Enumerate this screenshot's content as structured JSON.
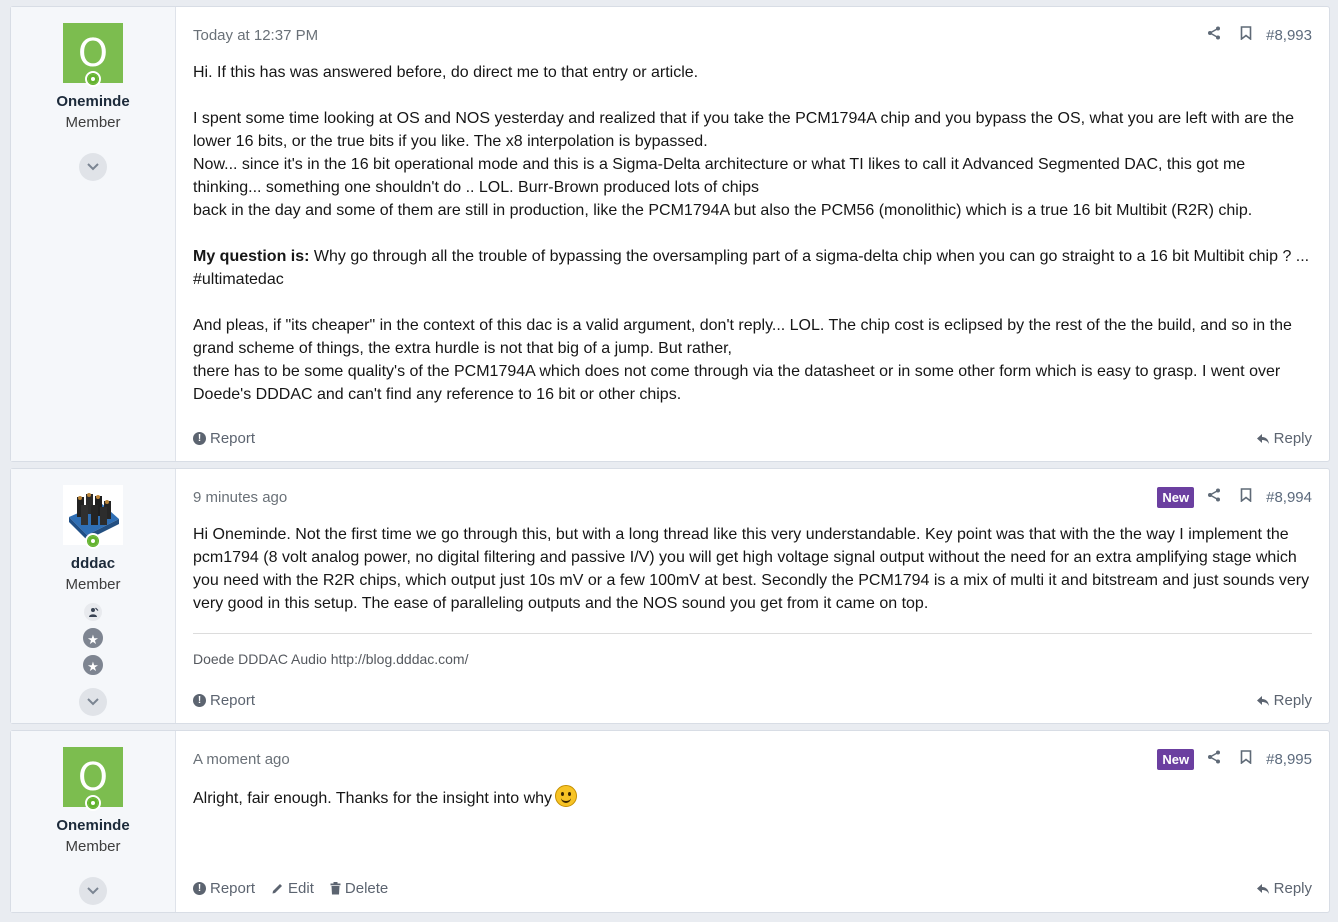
{
  "colors": {
    "online": "#63b32e",
    "new_badge": "#6b3fa0",
    "avatar_bg": "#7cbd4f"
  },
  "posts": [
    {
      "user": {
        "avatar_letter": "O",
        "name": "Oneminde",
        "title": "Member"
      },
      "date": "Today at 12:37 PM",
      "post_number": "#8,993",
      "is_new": false,
      "body": {
        "p1": "Hi. If this has was answered before, do direct me to that entry or article.",
        "p2a": "I spent some time looking at OS and NOS yesterday and realized that if you take the PCM1794A chip and you bypass the OS, what you are left with are the lower 16 bits, or the true bits if you like. The x8 interpolation is bypassed.",
        "p2b": "Now... since it's in the 16 bit operational mode and this is a Sigma-Delta architecture or what TI likes to call it Advanced Segmented DAC, this got me thinking... something one shouldn't do .. LOL. Burr-Brown produced lots of chips",
        "p2c": "back in the day and some of them are still in production, like the PCM1794A but also the PCM56 (monolithic) which is a true 16 bit Multibit (R2R) chip.",
        "q_label": "My question is:",
        "q_text": " Why go through all the trouble of bypassing the oversampling part of a sigma-delta chip when you can go straight to a 16 bit Multibit chip ? ... #ultimatedac",
        "p4a": "And pleas, if \"its cheaper\" in the context of this dac is a valid argument, don't reply... LOL. The chip cost is eclipsed by the rest of the the build, and so in the grand scheme of things, the extra hurdle is not that big of a jump. But rather,",
        "p4b": "there has to be some quality's of the PCM1794A which does not come through via the datasheet or in some other form which is easy to grasp. I went over Doede's DDDAC and can't find any reference to 16 bit or other chips."
      },
      "footer": {
        "report": "Report",
        "reply": "Reply"
      }
    },
    {
      "user": {
        "name": "dddac",
        "title": "Member"
      },
      "date": "9 minutes ago",
      "new_label": "New",
      "post_number": "#8,994",
      "body": "Hi Oneminde. Not the first time we go through this, but with a long thread like this very understandable. Key point was that with the the way I implement the pcm1794 (8 volt analog power, no digital filtering and passive I/V) you will get high voltage signal output without the need for an extra amplifying stage which you need with the R2R chips, which output just 10s mV or a few 100mV at best. Secondly the PCM1794 is a mix of multi it and bitstream and just sounds very very good in this setup. The ease of paralleling outputs and the NOS sound you get from it came on top.",
      "signature": "Doede DDDAC Audio http://blog.dddac.com/",
      "footer": {
        "report": "Report",
        "reply": "Reply"
      }
    },
    {
      "user": {
        "avatar_letter": "O",
        "name": "Oneminde",
        "title": "Member"
      },
      "date": "A moment ago",
      "new_label": "New",
      "post_number": "#8,995",
      "body": "Alright, fair enough. Thanks for the insight into why",
      "footer": {
        "report": "Report",
        "edit": "Edit",
        "delete": "Delete",
        "reply": "Reply"
      }
    }
  ]
}
